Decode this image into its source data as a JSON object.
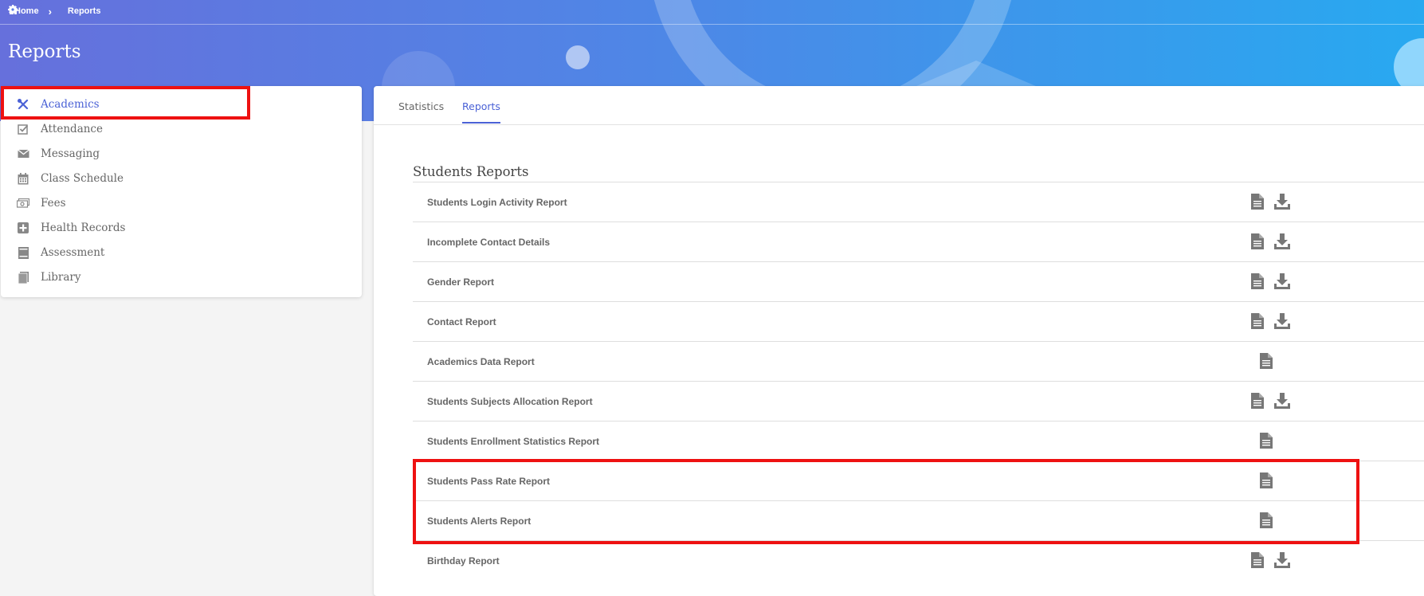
{
  "breadcrumb": {
    "home": "Home",
    "current": "Reports",
    "home_icon": "home-icon",
    "current_icon": "gear-icon",
    "separator_icon": "chevron-right-icon"
  },
  "page": {
    "title": "Reports"
  },
  "sidebar": {
    "items": [
      {
        "label": "Academics",
        "icon": "tools-icon",
        "active": true
      },
      {
        "label": "Attendance",
        "icon": "checkbox-icon"
      },
      {
        "label": "Messaging",
        "icon": "envelope-icon"
      },
      {
        "label": "Class Schedule",
        "icon": "calendar-icon"
      },
      {
        "label": "Fees",
        "icon": "money-icon"
      },
      {
        "label": "Health Records",
        "icon": "medical-plus-icon"
      },
      {
        "label": "Assessment",
        "icon": "assessment-icon"
      },
      {
        "label": "Library",
        "icon": "book-icon"
      }
    ]
  },
  "tabs": [
    {
      "label": "Statistics"
    },
    {
      "label": "Reports",
      "active": true
    }
  ],
  "section": {
    "title": "Students Reports"
  },
  "reports": [
    {
      "name": "Students Login Activity Report",
      "view": true,
      "download": true
    },
    {
      "name": "Incomplete Contact Details",
      "view": true,
      "download": true
    },
    {
      "name": "Gender Report",
      "view": true,
      "download": true
    },
    {
      "name": "Contact Report",
      "view": true,
      "download": true
    },
    {
      "name": "Academics Data Report",
      "view": true,
      "download": false
    },
    {
      "name": "Students Subjects Allocation Report",
      "view": true,
      "download": true
    },
    {
      "name": "Students Enrollment Statistics Report",
      "view": true,
      "download": false
    },
    {
      "name": "Students Pass Rate Report",
      "view": true,
      "download": false
    },
    {
      "name": "Students Alerts Report",
      "view": true,
      "download": false
    },
    {
      "name": "Birthday Report",
      "view": true,
      "download": true
    }
  ],
  "colors": {
    "accent": "#4b62d6",
    "highlight": "#ee1111",
    "icon": "#777777"
  }
}
